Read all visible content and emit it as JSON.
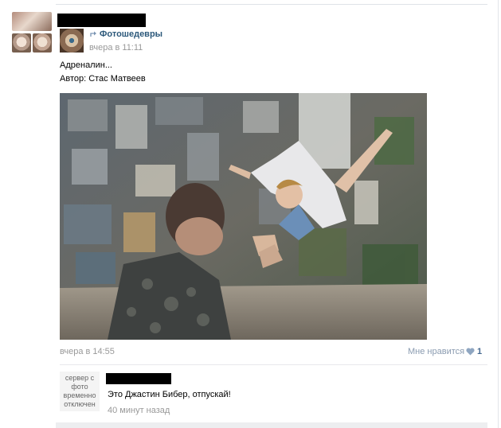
{
  "post": {
    "group_name": "Фотошедевры",
    "group_time": "вчера в 11:11",
    "text_line1": "Адреналин...",
    "text_line2": "Автор: Стас Матвеев",
    "date": "вчера в 14:55",
    "like_label": "Мне нравится",
    "like_count": "1"
  },
  "comment": {
    "avatar_placeholder": "сервер с фото временно отключен",
    "text": "Это Джастин Бибер, отпускай!",
    "time": "40 минут назад"
  },
  "colors": {
    "link": "#2b587a",
    "muted": "#999999",
    "like": "#8a9bb0"
  }
}
